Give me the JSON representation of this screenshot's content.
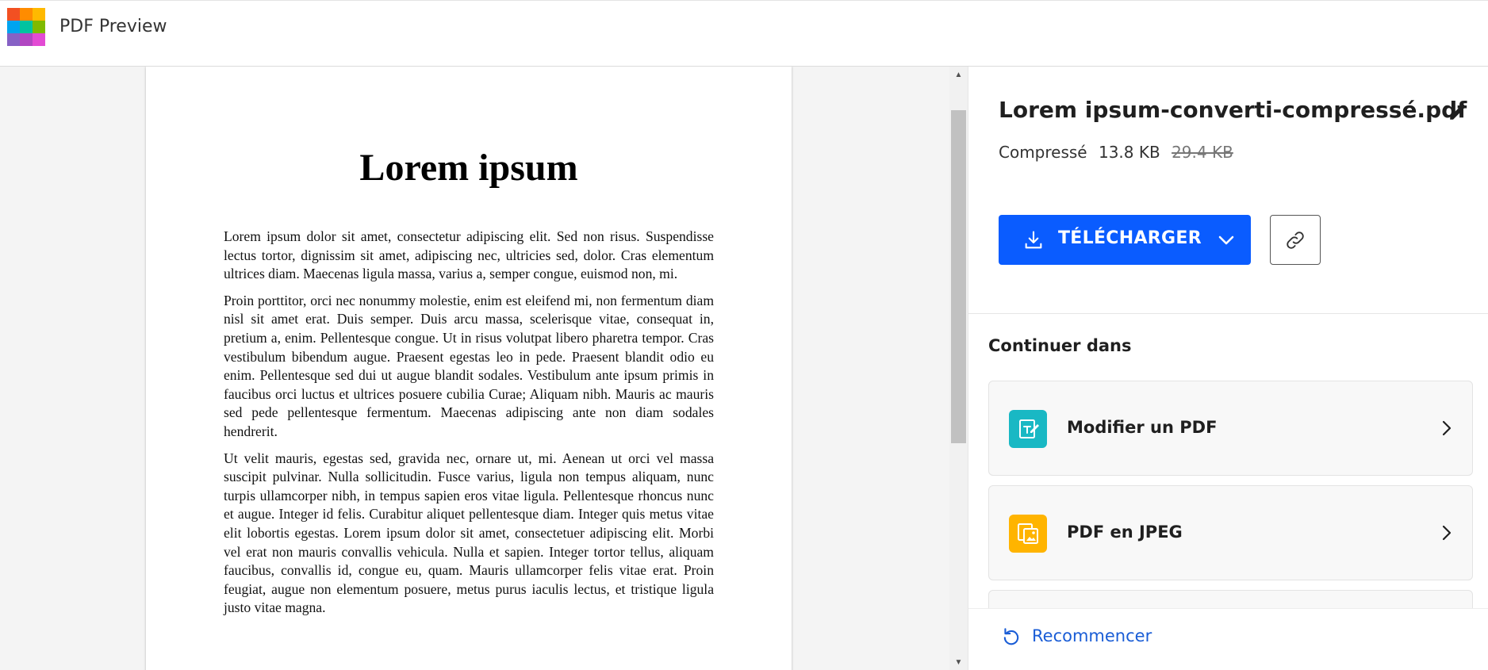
{
  "app": {
    "title": "PDF Preview",
    "logo_colors": [
      "#f25022",
      "#ff8c00",
      "#ffb900",
      "#00a4ef",
      "#00c3a0",
      "#7fba00",
      "#8661c5",
      "#b146c2",
      "#e34bd4"
    ]
  },
  "document": {
    "title": "Lorem ipsum",
    "paragraphs": [
      "Lorem ipsum dolor sit amet, consectetur adipiscing elit. Sed non risus. Suspendisse lectus tortor, dignissim sit amet, adipiscing nec, ultricies sed, dolor. Cras elementum ultrices diam. Maecenas ligula massa, varius a, semper congue, euismod non, mi.",
      "Proin porttitor, orci nec nonummy molestie, enim est eleifend mi, non fermentum diam nisl sit amet erat. Duis semper. Duis arcu massa, scelerisque vitae, consequat in, pretium a, enim. Pellentesque congue. Ut in risus volutpat libero pharetra tempor. Cras vestibulum bibendum augue. Praesent egestas leo in pede. Praesent blandit odio eu enim. Pellentesque sed dui ut augue blandit sodales. Vestibulum ante ipsum primis in faucibus orci luctus et ultrices posuere cubilia Curae; Aliquam nibh. Mauris ac mauris sed pede pellentesque fermentum. Maecenas adipiscing ante non diam sodales hendrerit.",
      "Ut velit mauris, egestas sed, gravida nec, ornare ut, mi. Aenean ut orci vel massa suscipit pulvinar. Nulla sollicitudin. Fusce varius, ligula non tempus aliquam, nunc turpis ullamcorper nibh, in tempus sapien eros vitae ligula. Pellentesque rhoncus nunc et augue. Integer id felis. Curabitur aliquet pellentesque diam. Integer quis metus vitae elit lobortis egestas. Lorem ipsum dolor sit amet, consectetuer adipiscing elit. Morbi vel erat non mauris convallis vehicula. Nulla et sapien. Integer tortor tellus, aliquam faucibus, convallis id, congue eu, quam. Mauris ullamcorper felis vitae erat. Proin feugiat, augue non elementum posuere, metus purus iaculis lectus, et tristique ligula justo vitae magna."
    ]
  },
  "panel": {
    "file_name": "Lorem ipsum-converti-compressé.pdf",
    "status_label": "Compressé",
    "size_new": "13.8 KB",
    "size_old": "29.4 KB",
    "download_label": "TÉLÉCHARGER",
    "continue_heading": "Continuer dans",
    "cards": [
      {
        "label": "Modifier un PDF",
        "icon": "edit-pdf-icon",
        "color": "#19b8c4"
      },
      {
        "label": "PDF en JPEG",
        "icon": "pdf-to-jpeg-icon",
        "color": "#ffb400"
      }
    ],
    "restart_label": "Recommencer"
  },
  "colors": {
    "accent": "#0a5cff",
    "link": "#1a5dd6"
  }
}
